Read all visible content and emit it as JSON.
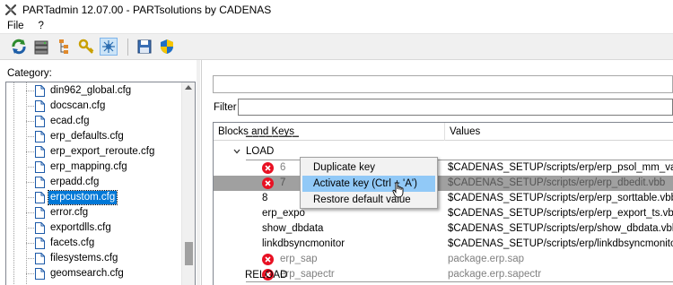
{
  "window": {
    "title": "PARTadmin 12.07.00 - PARTsolutions by CADENAS"
  },
  "menu": [
    {
      "label": "File"
    },
    {
      "label": "?"
    }
  ],
  "toolbar": {
    "icons": [
      "refresh-icon",
      "server-icon",
      "tree-icon",
      "key-icon",
      "network-icon",
      "save-icon",
      "shield-icon"
    ]
  },
  "sidebar": {
    "category_label": "Category:",
    "items": [
      {
        "label": "din962_global.cfg"
      },
      {
        "label": "docscan.cfg"
      },
      {
        "label": "ecad.cfg"
      },
      {
        "label": "erp_defaults.cfg"
      },
      {
        "label": "erp_export_reroute.cfg"
      },
      {
        "label": "erp_mapping.cfg"
      },
      {
        "label": "erpadd.cfg"
      },
      {
        "label": "erpcustom.cfg",
        "selected": true
      },
      {
        "label": "error.cfg"
      },
      {
        "label": "exportdlls.cfg"
      },
      {
        "label": "facets.cfg"
      },
      {
        "label": "filesystems.cfg"
      },
      {
        "label": "geomsearch.cfg"
      }
    ]
  },
  "filter": {
    "label": "Filter"
  },
  "grid": {
    "columns": {
      "keys": "Blocks and Keys",
      "values": "Values"
    },
    "groups": {
      "load": "LOAD",
      "reload": "RELOAD"
    },
    "rows": [
      {
        "key": "6",
        "value": "$CADENAS_SETUP/scripts/erp/erp_psol_mm_vars.vbb",
        "error": true,
        "disabled": true
      },
      {
        "key": "7",
        "value": "$CADENAS_SETUP/scripts/erp/erp_dbedit.vbb",
        "error": true,
        "disabled": true
      },
      {
        "key": "8",
        "value": "$CADENAS_SETUP/scripts/erp/erp_sorttable.vbb"
      },
      {
        "key": "erp_expo",
        "value": "$CADENAS_SETUP/scripts/erp/erp_export_ts.vbb"
      },
      {
        "key": "show_dbdata",
        "value": "$CADENAS_SETUP/scripts/erp/show_dbdata.vbb"
      },
      {
        "key": "linkdbsyncmonitor",
        "value": "$CADENAS_SETUP/scripts/erp/linkdbsyncmonitor.vbb"
      },
      {
        "key": "erp_sap",
        "value": "package.erp.sap",
        "error": true,
        "disabled": true
      },
      {
        "key": "erp_sapectr",
        "value": "package.erp.sapectr",
        "error": true,
        "disabled": true
      }
    ]
  },
  "context_menu": {
    "items": [
      {
        "label": "Duplicate key"
      },
      {
        "label": "Activate key (Ctrl + 'A')"
      },
      {
        "label": "Restore default value"
      }
    ]
  },
  "colors": {
    "selection": "#0078d7",
    "menu_hover": "#91c9f7",
    "error": "#e81123"
  }
}
